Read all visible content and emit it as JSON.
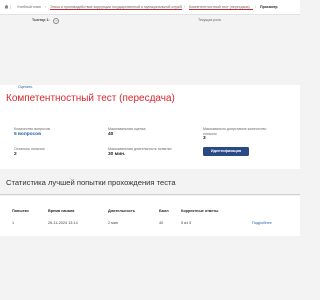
{
  "breadcrumb": {
    "items": [
      "Учебный план",
      "Этика и противодействие коррупции государственной и муниципальной службы",
      "Компетентностный тест (пересдача)",
      "Просмотр"
    ]
  },
  "toolbar": {
    "attempt_label": "Тьютор 1:",
    "help_glyph": "?",
    "right_label": "Текущая роль"
  },
  "rate_link": "Оценить",
  "page_title": "Компетентностный тест (пересдача)",
  "info": {
    "questions_label": "Количество вопросов",
    "questions_value": "5 вопросов",
    "max_score_label": "Максимальная оценка",
    "max_score_value": "40",
    "max_attempts_label": "Максимально допустимое количество попыток",
    "max_attempts_value": "3",
    "remaining_label": "Осталось попыток",
    "remaining_value": "2",
    "max_duration_label": "Максимальная длительность попытки",
    "max_duration_value": "30 мин.",
    "ident_button": "Идентификация"
  },
  "stats_title": "Статистика лучшей попытки прохождения теста",
  "table": {
    "headers": [
      "Попытки",
      "Время начала",
      "Длительность",
      "Балл",
      "Корректные ответы"
    ],
    "row": {
      "attempt": "1",
      "start": "26-11-2024 13:14",
      "duration": "2 мин",
      "score": "40",
      "correct": "5 из 5",
      "details": "Подробнее"
    }
  },
  "colors": {
    "accent_red": "#d9262e",
    "link_blue": "#1f5fa8",
    "button_navy": "#2a4a85"
  }
}
